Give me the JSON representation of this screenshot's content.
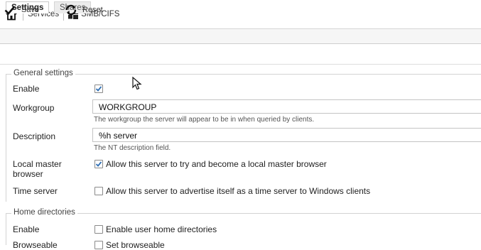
{
  "breadcrumb": {
    "services": "Services",
    "current": "SMB/CIFS"
  },
  "tabs": {
    "settings": "Settings",
    "shares": "Shares"
  },
  "toolbar": {
    "save": "Save",
    "reset": "Reset"
  },
  "general": {
    "legend": "General settings",
    "enable": {
      "label": "Enable",
      "checked": true
    },
    "workgroup": {
      "label": "Workgroup",
      "value": "WORKGROUP",
      "hint": "The workgroup the server will appear to be in when queried by clients."
    },
    "description": {
      "label": "Description",
      "value": "%h server",
      "hint": "The NT description field."
    },
    "local_master": {
      "label_line1": "Local master",
      "label_line2": "browser",
      "checked": true,
      "text": "Allow this server to try and become a local master browser"
    },
    "time_server": {
      "label": "Time server",
      "checked": false,
      "text": "Allow this server to advertise itself as a time server to Windows clients"
    }
  },
  "home": {
    "legend": "Home directories",
    "enable": {
      "label": "Enable",
      "checked": false,
      "text": "Enable user home directories"
    },
    "browseable": {
      "label": "Browseable",
      "checked": false,
      "text": "Set browseable"
    }
  },
  "colors": {
    "check": "#2f6fb4",
    "border": "#c4c4c4"
  }
}
